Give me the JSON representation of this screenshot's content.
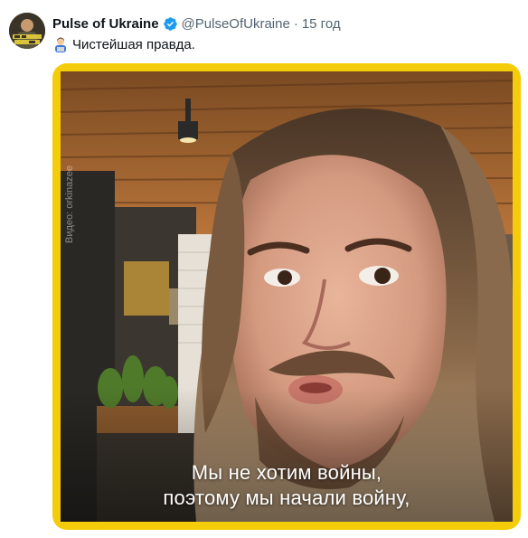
{
  "tweet": {
    "author_name": "Pulse of Ukraine",
    "author_handle": "@PulseOfUkraine",
    "separator": "·",
    "timestamp": "15 год",
    "text": "Чистейшая правда.",
    "verified_icon": "verified-badge-icon",
    "emoji_icon": "man-technologist-emoji-icon"
  },
  "media": {
    "type": "video",
    "watermark": "Видео: orkinazee",
    "subtitles": [
      "Мы не хотим войны,",
      "поэтому мы начали войну,"
    ],
    "border_color": "#f5cc0a"
  },
  "colors": {
    "text": "#0f1419",
    "secondary": "#536471",
    "verified": "#1d9bf0"
  }
}
